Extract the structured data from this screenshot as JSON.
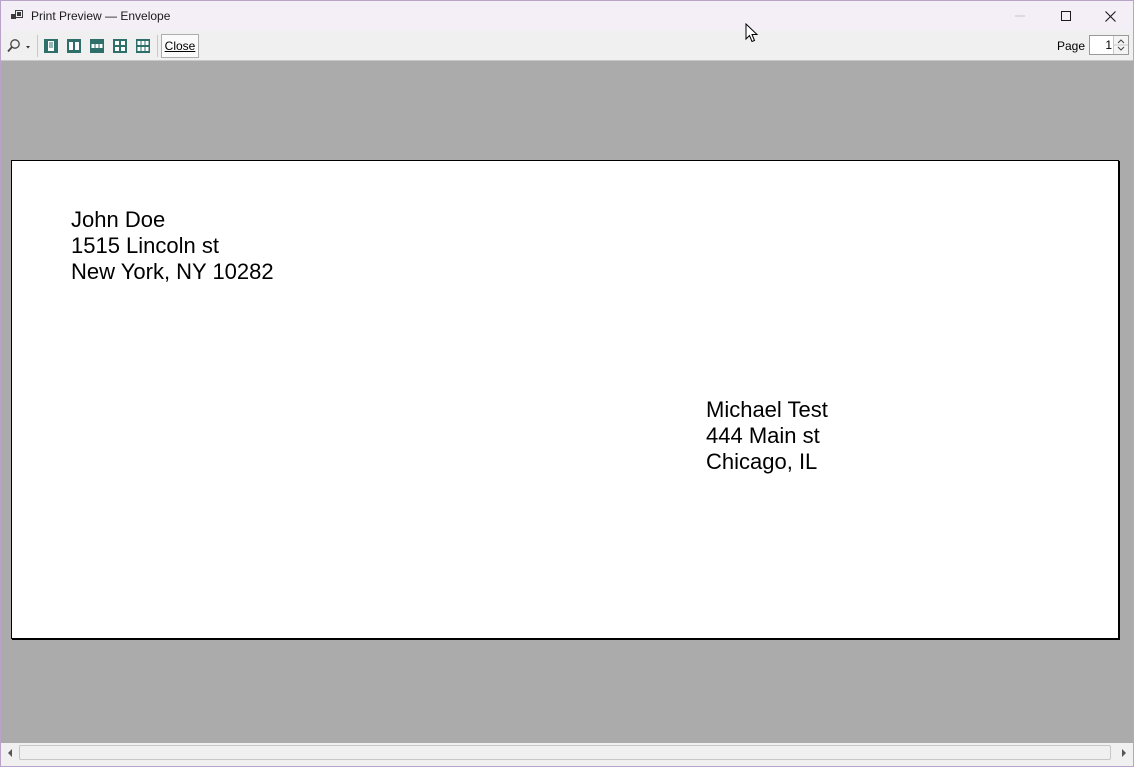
{
  "window": {
    "title": "Print Preview — Envelope",
    "controls": {
      "minimize": "minimize-icon",
      "maximize": "maximize-icon",
      "close": "close-icon"
    }
  },
  "toolbar": {
    "zoom_icon": "magnifier-icon",
    "layouts": [
      "one-page-icon",
      "two-pages-icon",
      "three-pages-icon",
      "four-pages-icon",
      "six-pages-icon"
    ],
    "close_label": "Close",
    "page_label": "Page",
    "page_value": "1"
  },
  "envelope": {
    "sender": [
      "John Doe",
      "1515 Lincoln st",
      "New York, NY 10282"
    ],
    "recipient": [
      "Michael Test",
      "444 Main st",
      "Chicago, IL"
    ]
  },
  "colors": {
    "preview_background": "#ababab",
    "paper": "#ffffff",
    "icon_teal": "#2f6f6a",
    "titlebar": "#f4eef7"
  }
}
